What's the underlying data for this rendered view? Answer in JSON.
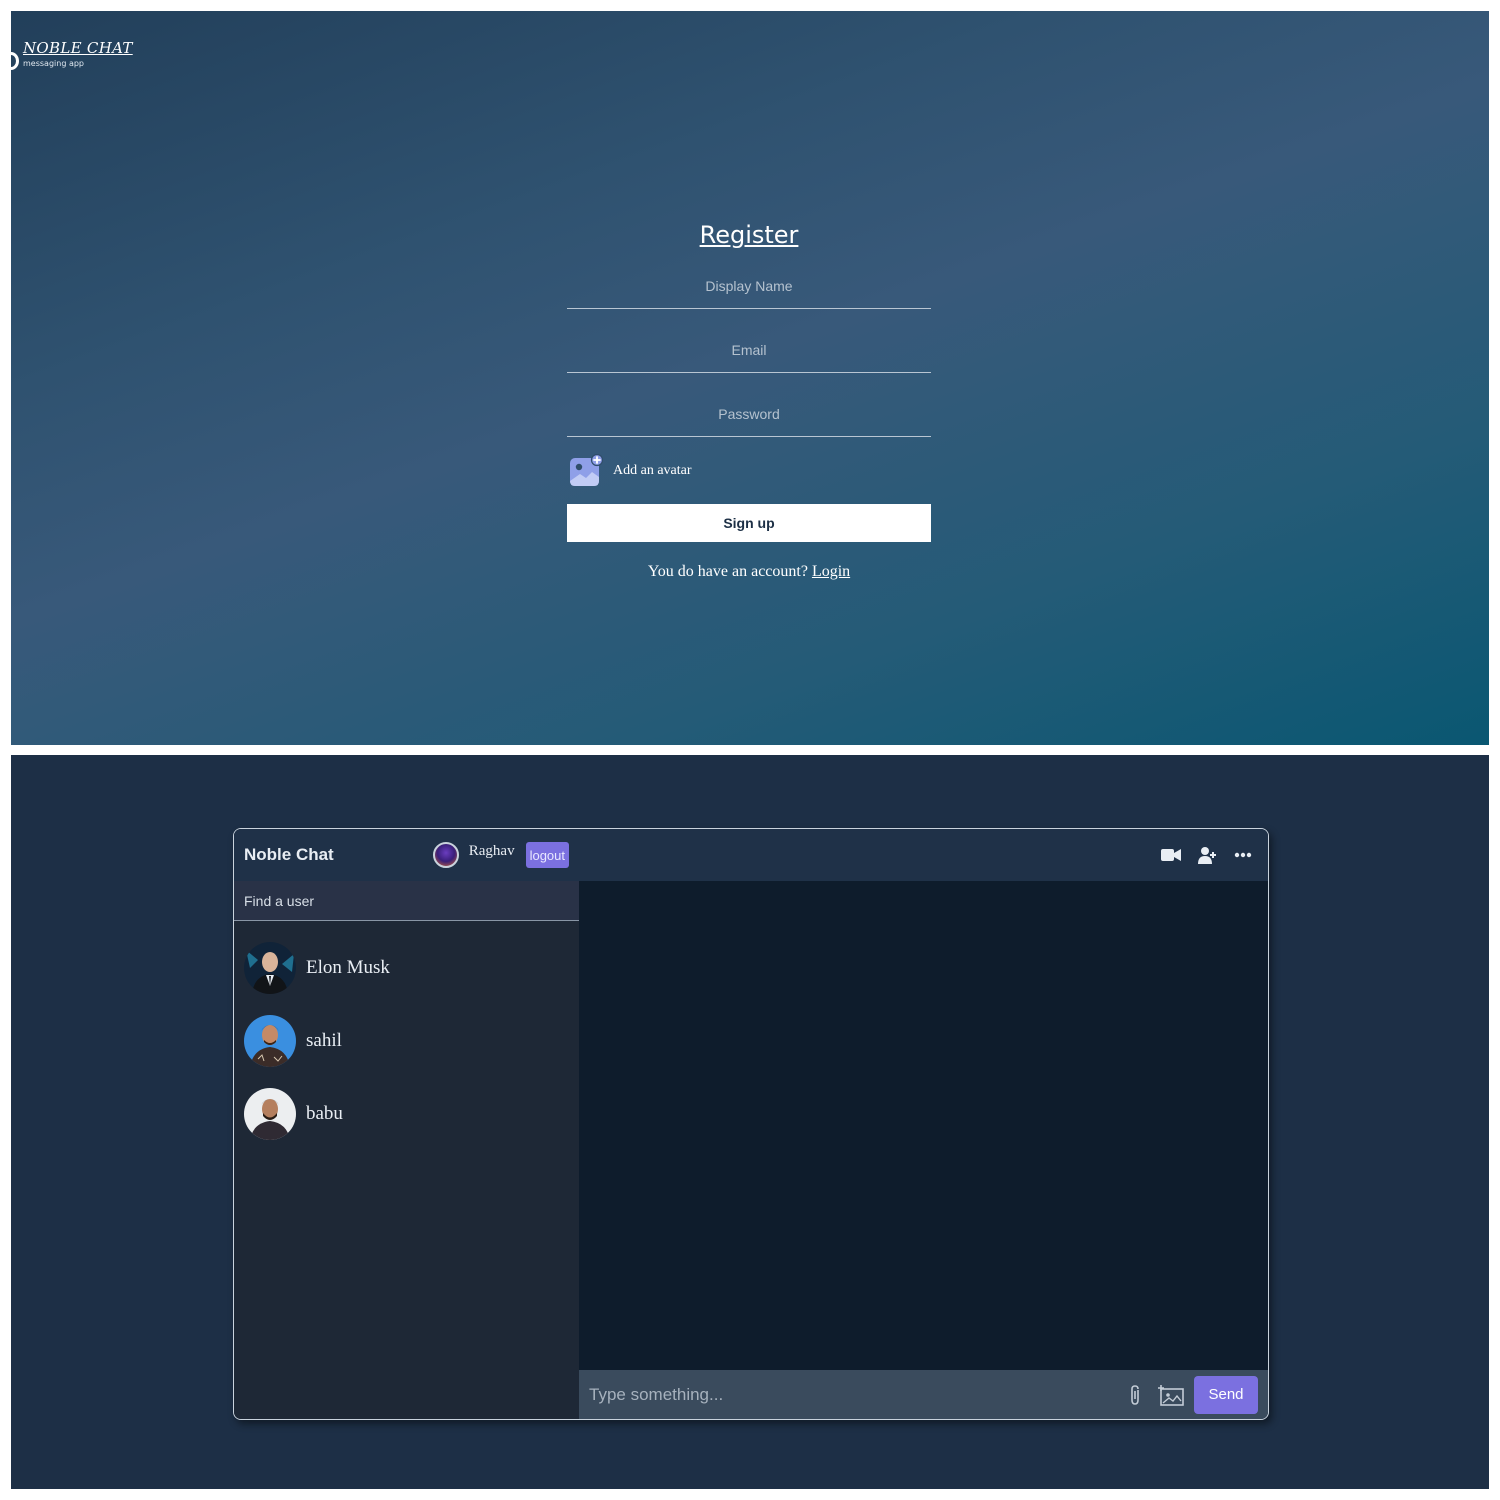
{
  "register": {
    "brand_name": "NOBLE CHAT",
    "brand_tagline": "messaging app",
    "title": "Register",
    "display_name_placeholder": "Display Name",
    "email_placeholder": "Email",
    "password_placeholder": "Password",
    "avatar_label": "Add an avatar",
    "avatar_icon": "add-image-icon",
    "signup_label": "Sign up",
    "account_prompt": "You do have an account?",
    "login_link": "Login"
  },
  "chat": {
    "app_name": "Noble Chat",
    "current_user": {
      "name": "Raghav"
    },
    "logout_label": "logout",
    "search_placeholder": "Find a user",
    "users": [
      {
        "name": "Elon Musk"
      },
      {
        "name": "sahil"
      },
      {
        "name": "babu"
      }
    ],
    "header_icons": [
      "video-camera-icon",
      "add-user-icon",
      "more-options-icon"
    ],
    "composer_placeholder": "Type something...",
    "composer_icons": [
      "paperclip-icon",
      "add-image-icon"
    ],
    "send_label": "Send"
  },
  "colors": {
    "accent": "#7b70e0",
    "chat_background": "#1d2f46",
    "messages_background": "#0e1c2c",
    "sidebar_background": "#1e2836"
  }
}
